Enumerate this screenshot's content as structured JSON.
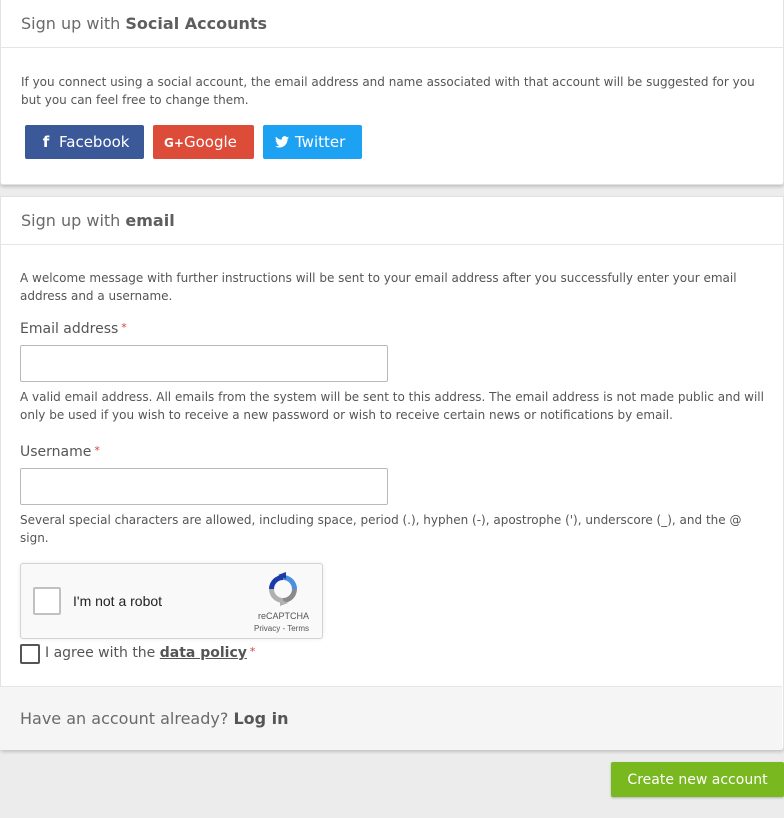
{
  "social": {
    "heading_prefix": "Sign up with",
    "heading_strong": "Social Accounts",
    "help": "If you connect using a social account, the email address and name associated with that account will be suggested for you but you can feel free to change them.",
    "buttons": [
      {
        "label": "Facebook",
        "icon": "facebook-icon",
        "color": "#3b5998"
      },
      {
        "label": "Google",
        "icon": "google-plus-icon",
        "color": "#dd4b39"
      },
      {
        "label": "Twitter",
        "icon": "twitter-icon",
        "color": "#1da1f2"
      }
    ]
  },
  "email_section": {
    "heading_prefix": "Sign up with",
    "heading_strong": "email",
    "help": "A welcome message with further instructions will be sent to your email address after you successfully enter your email address and a username.",
    "email": {
      "label": "Email address",
      "required_mark": "*",
      "value": "",
      "description": "A valid email address. All emails from the system will be sent to this address. The email address is not made public and will only be used if you wish to receive a new password or wish to receive certain news or notifications by email."
    },
    "username": {
      "label": "Username",
      "required_mark": "*",
      "value": "",
      "description": "Several special characters are allowed, including space, period (.), hyphen (-), apostrophe ('), underscore (_), and the @ sign."
    },
    "captcha": {
      "label": "I'm not a robot",
      "brand": "reCAPTCHA",
      "legal": "Privacy - Terms"
    },
    "agree": {
      "prefix": "I agree with the",
      "link": "data policy",
      "required_mark": "*"
    }
  },
  "footer": {
    "text": "Have an account already?",
    "link": "Log in"
  },
  "submit_label": "Create new account"
}
